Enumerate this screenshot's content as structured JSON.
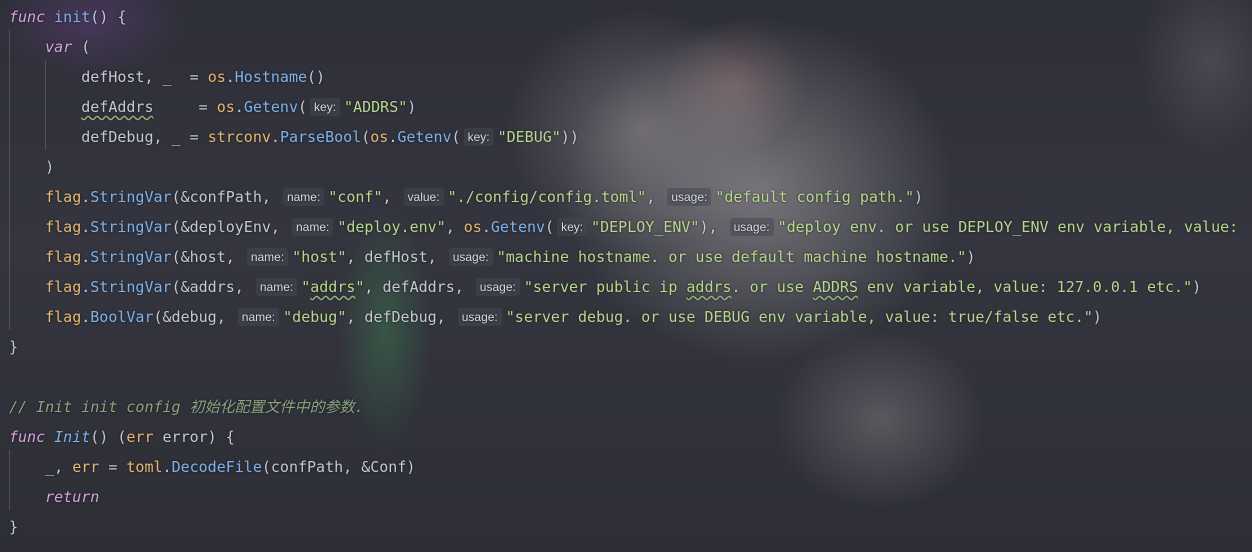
{
  "code": {
    "l1_func": "func",
    "l1_init": "init",
    "l1_rest": "() {",
    "l2_var": "var",
    "l2_rest": " (",
    "l3_name": "defHost, _  = ",
    "l3_os": "os",
    "l3_dot": ".",
    "l3_fn": "Hostname",
    "l3_rest": "()",
    "l4_name": "defAddrs",
    "l4_pad": "     = ",
    "l4_os": "os",
    "l4_dot": ".",
    "l4_fn": "Getenv",
    "l4_paren": "(",
    "l4_hint": "key:",
    "l4_str": "\"ADDRS\"",
    "l4_rest": ")",
    "l5_name": "defDebug, _ = ",
    "l5_pkg": "strconv",
    "l5_dot": ".",
    "l5_fn": "ParseBool",
    "l5_paren": "(",
    "l5_os": "os",
    "l5_dot2": ".",
    "l5_fn2": "Getenv",
    "l5_paren2": "(",
    "l5_hint": "key:",
    "l5_str": "\"DEBUG\"",
    "l5_rest": "))",
    "l6": ")",
    "l7_pkg": "flag",
    "l7_dot": ".",
    "l7_fn": "StringVar",
    "l7_arg": "(&confPath,",
    "l7_hint1": "name:",
    "l7_str1": "\"conf\"",
    "l7_c1": ",",
    "l7_hint2": "value:",
    "l7_str2": "\"./config/config.toml\"",
    "l7_c2": ",",
    "l7_hint3": "usage:",
    "l7_str3": "\"default config path.\"",
    "l7_rest": ")",
    "l8_pkg": "flag",
    "l8_dot": ".",
    "l8_fn": "StringVar",
    "l8_arg": "(&deployEnv,",
    "l8_hint1": "name:",
    "l8_str1": "\"deploy.env\"",
    "l8_c1": ", ",
    "l8_os": "os",
    "l8_dot2": ".",
    "l8_fn2": "Getenv",
    "l8_paren": "(",
    "l8_hint2": "key:",
    "l8_str2": "\"DEPLOY_ENV\"",
    "l8_c2": "),",
    "l8_hint3": "usage:",
    "l8_str3": "\"deploy env. or use DEPLOY_ENV env variable, value:",
    "l9_pkg": "flag",
    "l9_dot": ".",
    "l9_fn": "StringVar",
    "l9_arg": "(&host,",
    "l9_hint1": "name:",
    "l9_str1": "\"host\"",
    "l9_mid": ", defHost,",
    "l9_hint2": "usage:",
    "l9_str2": "\"machine hostname. or use default machine hostname.\"",
    "l9_rest": ")",
    "l10_pkg": "flag",
    "l10_dot": ".",
    "l10_fn": "StringVar",
    "l10_arg": "(&addrs,",
    "l10_hint1": "name:",
    "l10_str1a": "\"",
    "l10_str1b": "addrs",
    "l10_str1c": "\"",
    "l10_mid": ", defAddrs,",
    "l10_hint2": "usage:",
    "l10_str2a": "\"server public ip ",
    "l10_str2b": "addrs",
    "l10_str2c": ". or use ",
    "l10_str2d": "ADDRS",
    "l10_str2e": " env variable, value: 127.0.0.1 etc.\"",
    "l10_rest": ")",
    "l11_pkg": "flag",
    "l11_dot": ".",
    "l11_fn": "BoolVar",
    "l11_arg": "(&debug,",
    "l11_hint1": "name:",
    "l11_str1": "\"debug\"",
    "l11_mid": ", defDebug,",
    "l11_hint2": "usage:",
    "l11_str2": "\"server debug. or use DEBUG env variable, value: true/false etc.\"",
    "l11_rest": ")",
    "l12": "}",
    "l14_comment": "// Init init config 初始化配置文件中的参数.",
    "l15_func": "func",
    "l15_fn": "Init",
    "l15_a": "() (",
    "l15_err": "err",
    "l15_b": " error) {",
    "l16_a": "_, ",
    "l16_err": "err",
    "l16_b": " = ",
    "l16_pkg": "toml",
    "l16_dot": ".",
    "l16_fn": "DecodeFile",
    "l16_rest": "(confPath, &Conf)",
    "l17_return": "return",
    "l18": "}"
  },
  "colors": {
    "keyword": "#d6a3df",
    "function": "#7fb4ea",
    "package": "#e6b873",
    "string": "#b9d88c",
    "comment": "#8aa57f",
    "identifier": "#c6c9d2"
  }
}
